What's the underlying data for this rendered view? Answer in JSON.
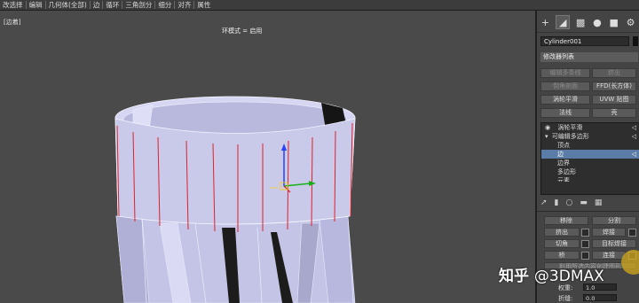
{
  "menu": {
    "items": [
      "改选择",
      "编辑",
      "几何体(全部)",
      "边",
      "循环",
      "三角剖分",
      "细分",
      "对齐",
      "属性"
    ]
  },
  "viewport": {
    "label": "[边着]",
    "mode_text": "环模式 = 启用"
  },
  "command_panel": {
    "tabs": [
      "create-icon",
      "modify-icon",
      "hierarchy-icon",
      "motion-icon",
      "display-icon",
      "utilities-icon"
    ],
    "object_name": "Cylinder001",
    "modifier_list_label": "修改器列表",
    "quick_buttons": [
      {
        "label": "编辑多条线",
        "enabled": false
      },
      {
        "label": "挤出",
        "enabled": false
      },
      {
        "label": "倒角剖面",
        "enabled": false
      },
      {
        "label": "FFD(长方体)",
        "enabled": true
      },
      {
        "label": "涡轮平滑",
        "enabled": true
      },
      {
        "label": "UVW 贴图",
        "enabled": true
      },
      {
        "label": "法线",
        "enabled": true
      },
      {
        "label": "壳",
        "enabled": true
      }
    ],
    "stack": [
      {
        "label": "涡轮平滑",
        "indent": 1,
        "selected": false
      },
      {
        "label": "可编辑多边形",
        "indent": 1,
        "selected": false
      },
      {
        "label": "顶点",
        "indent": 2,
        "selected": false
      },
      {
        "label": "边",
        "indent": 2,
        "selected": true
      },
      {
        "label": "边界",
        "indent": 2,
        "selected": false
      },
      {
        "label": "多边形",
        "indent": 2,
        "selected": false
      },
      {
        "label": "元素",
        "indent": 2,
        "selected": false
      }
    ],
    "edit_edges": {
      "remove_label": "移除",
      "split_label": "分割",
      "extrude_label": "挤出",
      "weld_label": "焊接",
      "chamfer_label": "切角",
      "target_weld_label": "目标焊接",
      "bridge_label": "桥",
      "connect_label": "连接",
      "weight_label": "权重:",
      "weight_value": "1.0",
      "crease_label": "折缝:",
      "crease_value": "0.0",
      "truncated_text": "利用所选内容创建图形"
    }
  },
  "watermark": {
    "brand": "知乎",
    "handle": "@3DMAX"
  },
  "colors": {
    "selected_edge": "#e0202a",
    "mesh_face": "#c8c8ea",
    "highlight": "#d4aa1e"
  }
}
